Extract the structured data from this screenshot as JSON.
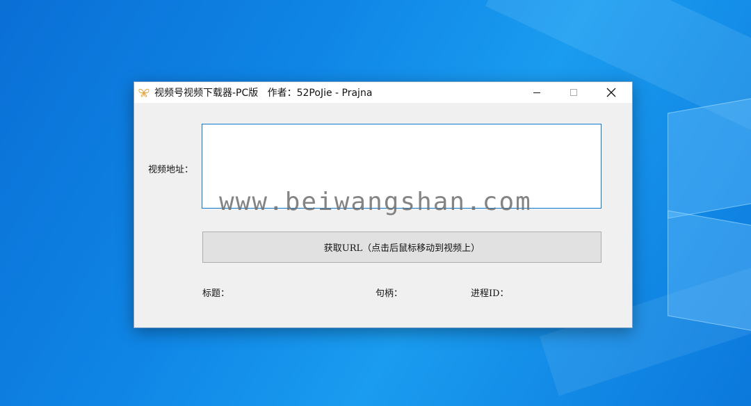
{
  "window": {
    "title": "视频号视频下载器-PC版   作者：52PoJie - Prajna"
  },
  "form": {
    "url_label": "视频地址：",
    "url_value": "",
    "button_label": "获取URL（点击后鼠标移动到视频上）",
    "title_label": "标题：",
    "handle_label": "句柄：",
    "pid_label": "进程ID："
  },
  "overlay": {
    "watermark": "www.beiwangshan.com"
  },
  "colors": {
    "accent": "#0b78d0",
    "desktop": "#0f86e6"
  },
  "icons": {
    "app": "butterfly-icon",
    "minimize": "minimize-icon",
    "maximize": "maximize-icon",
    "close": "close-icon"
  }
}
